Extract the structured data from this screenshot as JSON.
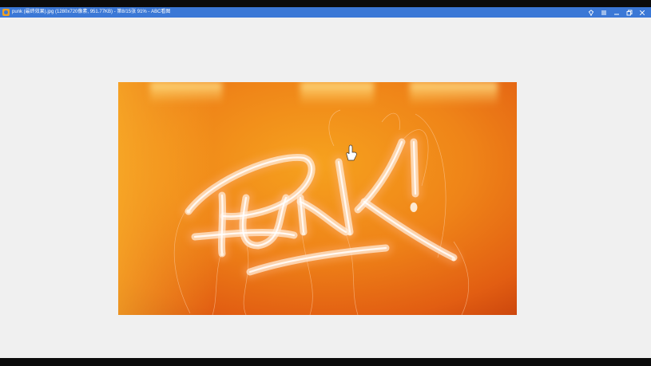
{
  "window": {
    "title": "punk (最终效果).jpg (1280x720像素, 951.77KB) - 第8/15张 91% - ABC看图",
    "accent_color": "#3b78d6"
  },
  "controls": {
    "pin_icon": "pin-icon",
    "menu_icon": "menu-icon",
    "minimize_icon": "minimize-icon",
    "restore_icon": "restore-icon",
    "close_icon": "close-icon"
  },
  "image": {
    "neon_text": "PUNK!",
    "background_color": "#e8761a",
    "neon_color": "#fff3e6"
  }
}
